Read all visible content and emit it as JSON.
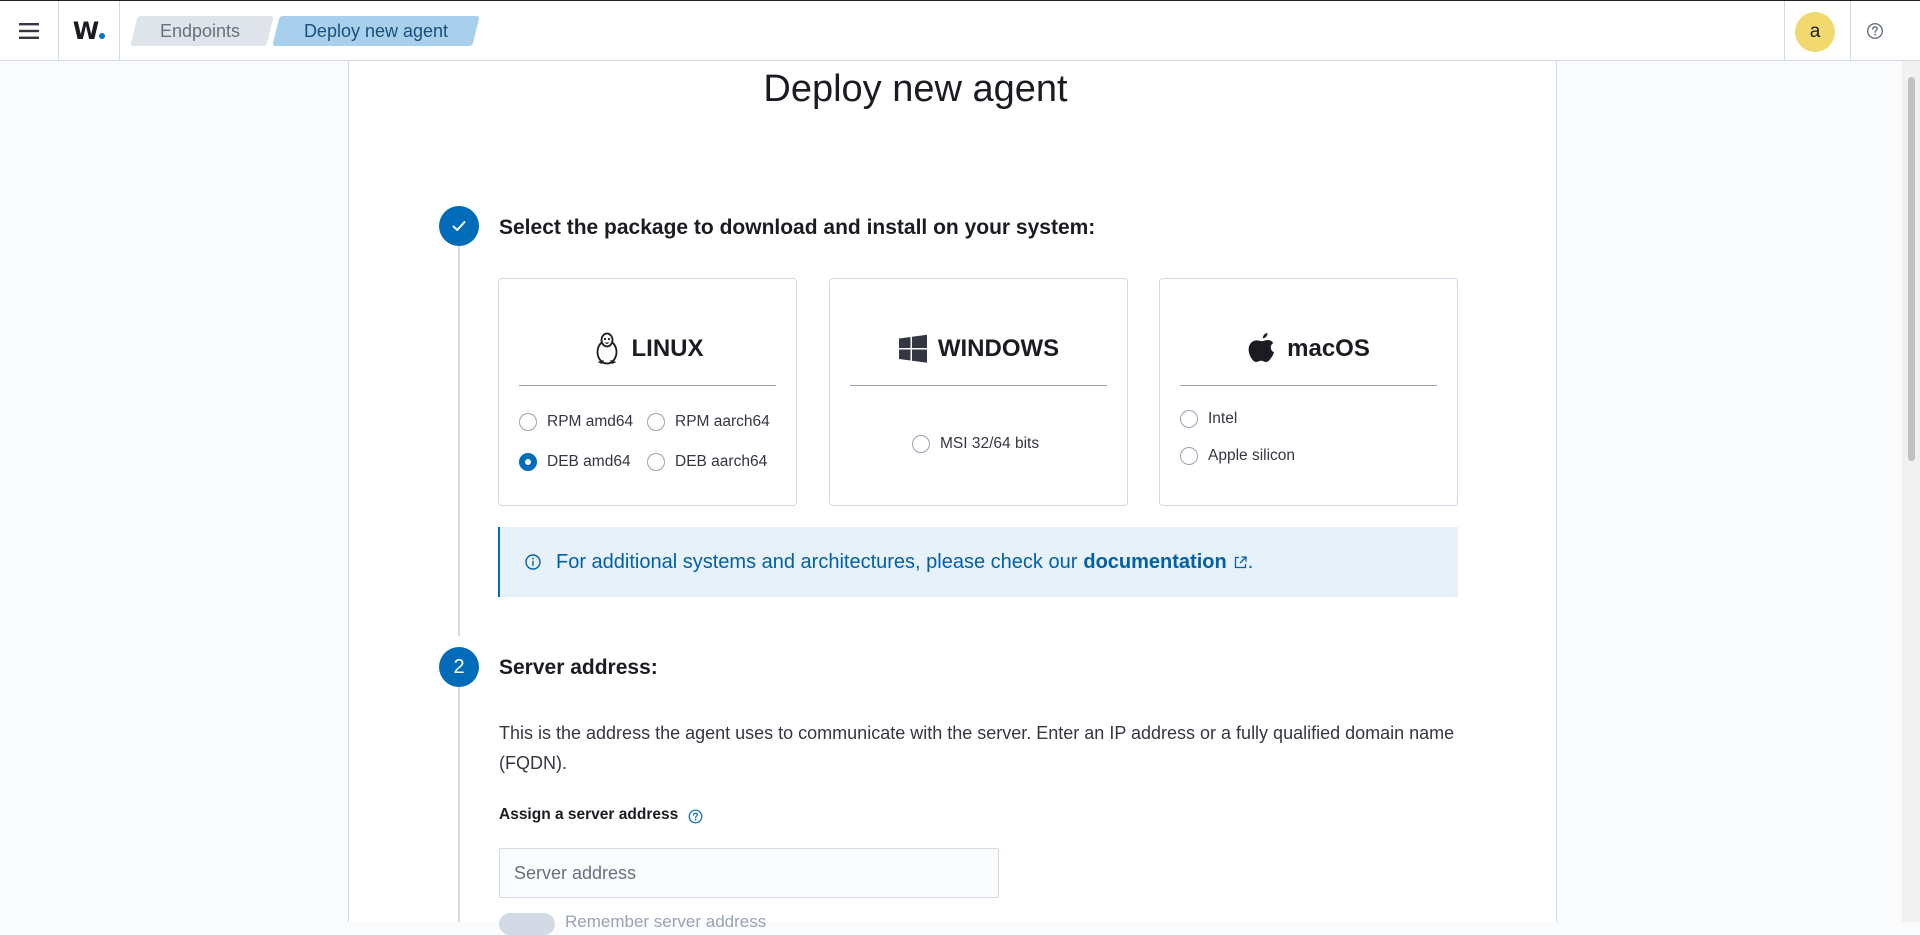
{
  "header": {
    "logo_text": "W.",
    "breadcrumbs": [
      "Endpoints",
      "Deploy new agent"
    ],
    "avatar_initial": "a",
    "menu_icon": "hamburger-icon",
    "help_icon": "question-circle-icon"
  },
  "page": {
    "title": "Deploy new agent"
  },
  "step1": {
    "title": "Select the package to download and install on your system:",
    "status_icon": "check-icon",
    "cards": {
      "linux": {
        "title": "LINUX",
        "icon": "linux-penguin-icon",
        "options": [
          "RPM amd64",
          "RPM aarch64",
          "DEB amd64",
          "DEB aarch64"
        ],
        "selected": "DEB amd64"
      },
      "windows": {
        "title": "WINDOWS",
        "icon": "windows-icon",
        "options": [
          "MSI 32/64 bits"
        ]
      },
      "macos": {
        "title": "macOS",
        "icon": "apple-icon",
        "options": [
          "Intel",
          "Apple silicon"
        ]
      }
    },
    "callout": {
      "text": "For additional systems and architectures, please check our",
      "link": "documentation",
      "suffix": "."
    }
  },
  "step2": {
    "number": "2",
    "title": "Server address:",
    "description": "This is the address the agent uses to communicate with the server. Enter an IP address or a fully qualified domain name (FQDN).",
    "field_label": "Assign a server address",
    "input_placeholder": "Server address",
    "toggle_label": "Remember server address"
  },
  "colors": {
    "primary": "#006bb8",
    "callout_bg": "#e6f1fa",
    "active_crumb": "#a8d0ec",
    "avatar": "#f1d86f"
  }
}
